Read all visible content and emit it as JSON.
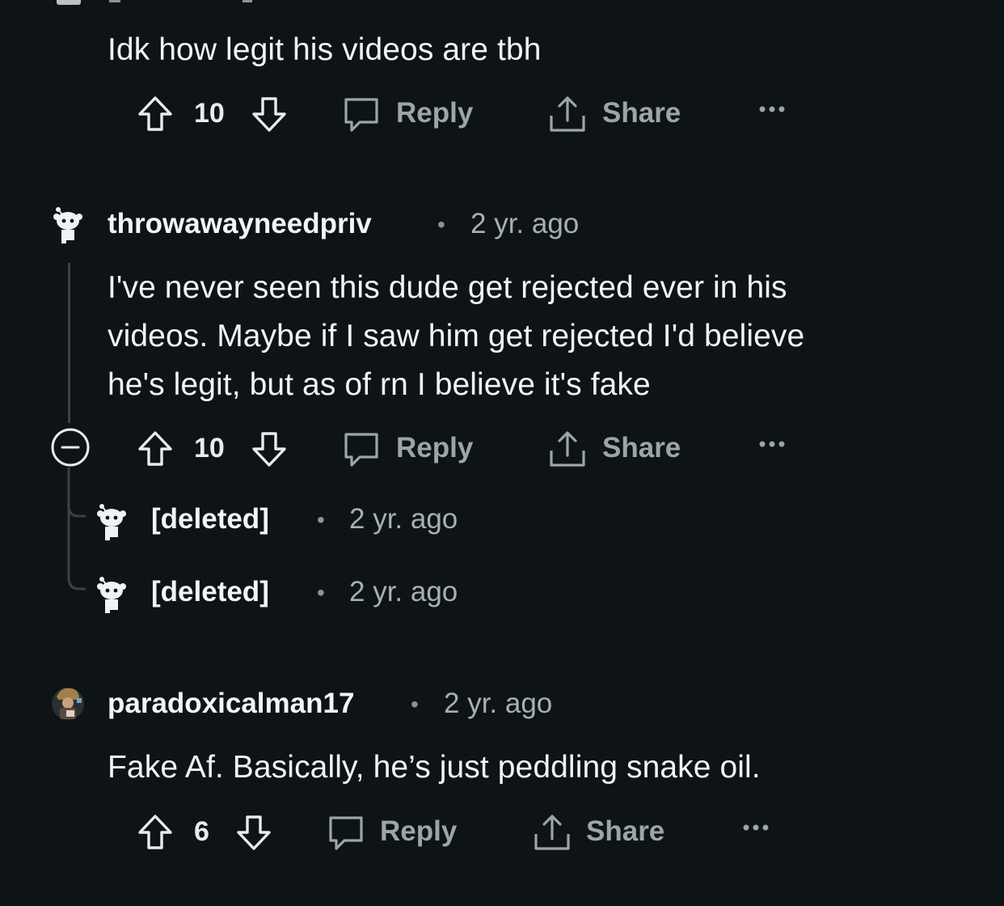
{
  "comments": [
    {
      "body": "Idk how legit his videos are tbh",
      "votes": "10",
      "reply_label": "Reply",
      "share_label": "Share",
      "more_icon": "ellipsis-icon"
    },
    {
      "username": "throwawayneedpriv",
      "separator": "•",
      "timestamp": "2 yr. ago",
      "avatar_icon": "snoo-avatar-icon",
      "body_lines": [
        "I've never seen this dude get rejected ever in his",
        "videos. Maybe if I saw him get rejected I'd believe",
        "he's legit, but as of rn I believe it's fake"
      ],
      "votes": "10",
      "reply_label": "Reply",
      "share_label": "Share",
      "collapse_icon": "collapse-minus-icon",
      "replies": [
        {
          "username": "[deleted]",
          "separator": "•",
          "timestamp": "2 yr. ago",
          "avatar_icon": "snoo-avatar-icon"
        },
        {
          "username": "[deleted]",
          "separator": "•",
          "timestamp": "2 yr. ago",
          "avatar_icon": "snoo-avatar-icon"
        }
      ]
    },
    {
      "username": "paradoxicalman17",
      "separator": "•",
      "timestamp": "2 yr. ago",
      "avatar_icon": "user-avatar-image",
      "body": "Fake Af. Basically, he’s just peddling snake oil.",
      "votes": "6",
      "reply_label": "Reply",
      "share_label": "Share"
    }
  ],
  "colors": {
    "background": "#0e1416",
    "text": "#f1f3f4",
    "muted": "#a6b0b5",
    "action": "#9ba5aa"
  }
}
